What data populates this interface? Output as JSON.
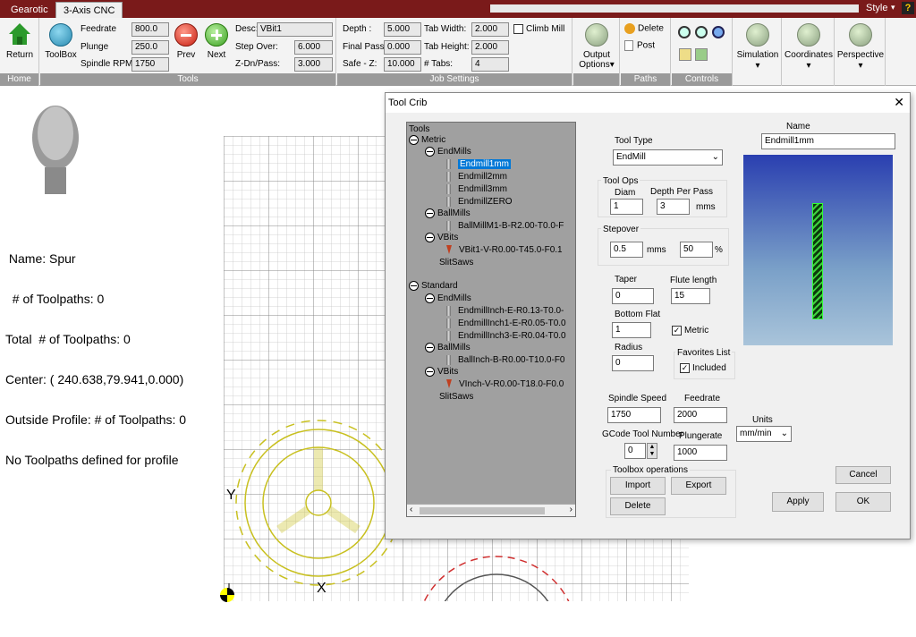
{
  "tabs": [
    "Gearotic",
    "3-Axis CNC"
  ],
  "style_label": "Style",
  "home": {
    "return": "Return",
    "group": "Home"
  },
  "tools": {
    "toolbox": "ToolBox",
    "feedrate_label": "Feedrate",
    "feedrate": "800.0",
    "plunge_label": "Plunge",
    "plunge": "250.0",
    "rpm_label": "Spindle RPM",
    "rpm": "1750",
    "prev": "Prev",
    "next": "Next",
    "desc_label": "Desc:",
    "desc": "VBit1",
    "stepover_label": "Step Over:",
    "stepover": "6.000",
    "zdn_label": "Z-Dn/Pass:",
    "zdn": "3.000",
    "group": "Tools"
  },
  "job": {
    "depth_label": "Depth :",
    "depth": "5.000",
    "final_label": "Final Pass:",
    "final": "0.000",
    "safe_label": "Safe - Z:",
    "safe": "10.000",
    "tabw_label": "Tab Width:",
    "tabw": "2.000",
    "tabh_label": "Tab Height:",
    "tabh": "2.000",
    "ntabs_label": "# Tabs:",
    "ntabs": "4",
    "climb": "Climb Mill",
    "group": "Job Settings"
  },
  "output": {
    "label1": "Output",
    "label2": "Options"
  },
  "paths": {
    "delete": "Delete",
    "post": "Post",
    "group": "Paths"
  },
  "controls": {
    "group": "Controls"
  },
  "right": {
    "simulation": "Simulation",
    "coordinates": "Coordinates",
    "perspective": "Perspective"
  },
  "info": {
    "line1": " Name: Spur",
    "line2": "  # of Toolpaths: 0",
    "line3": "Total  # of Toolpaths: 0",
    "line4": "Center: ( 240.638,79.941,0.000)",
    "line5": "Outside Profile: # of Toolpaths: 0",
    "line6": "No Toolpaths defined for profile"
  },
  "axes": {
    "y": "Y",
    "x": "X"
  },
  "dialog": {
    "title": "Tool Crib",
    "tree": {
      "root": "Tools",
      "metric": "Metric",
      "endmills": "EndMills",
      "em1": "Endmill1mm",
      "em2": "Endmill2mm",
      "em3": "Endmill3mm",
      "emz": "EndmillZERO",
      "ballmills": "BallMills",
      "bm1": "BallMillM1-B-R2.00-T0.0-F",
      "vbits": "VBits",
      "vb1": "VBit1-V-R0.00-T45.0-F0.1",
      "slitsaws": "SlitSaws",
      "standard": "Standard",
      "s_endmills": "EndMills",
      "se1": "EndmillInch-E-R0.13-T0.0-",
      "se2": "EndmillInch1-E-R0.05-T0.0",
      "se3": "EndmillInch3-E-R0.04-T0.0",
      "s_ballmills": "BallMills",
      "sb1": "BallInch-B-R0.00-T10.0-F0",
      "s_vbits": "VBits",
      "sv1": "VInch-V-R0.00-T18.0-F0.0",
      "s_slitsaws": "SlitSaws"
    },
    "tool_type_label": "Tool Type",
    "tool_type": "EndMill",
    "tool_ops": "Tool Ops",
    "diam_label": "Diam",
    "diam": "1",
    "dpp_label": "Depth Per Pass",
    "dpp": "3",
    "dpp_unit": "mms",
    "stepover_label": "Stepover",
    "stepover_mm": "0.5",
    "mms": "mms",
    "stepover_pct": "50",
    "pct": "%",
    "taper_label": "Taper",
    "taper": "0",
    "flute_label": "Flute length",
    "flute": "15",
    "bottom_label": "Bottom Flat",
    "bottom": "1",
    "metric": "Metric",
    "radius_label": "Radius",
    "radius": "0",
    "fav_label": "Favorites List",
    "included": "Included",
    "spindle_label": "Spindle Speed",
    "spindle": "1750",
    "feed_label": "Feedrate",
    "feed": "2000",
    "gcode_label": "GCode Tool Number",
    "gcode": "0",
    "plunge_label": "Plungerate",
    "plunge": "1000",
    "toolbox_ops": "Toolbox operations",
    "import": "Import",
    "export": "Export",
    "delete": "Delete",
    "name_label": "Name",
    "name": "Endmill1mm",
    "units_label": "Units",
    "units": "mm/min",
    "cancel": "Cancel",
    "apply": "Apply",
    "ok": "OK"
  }
}
